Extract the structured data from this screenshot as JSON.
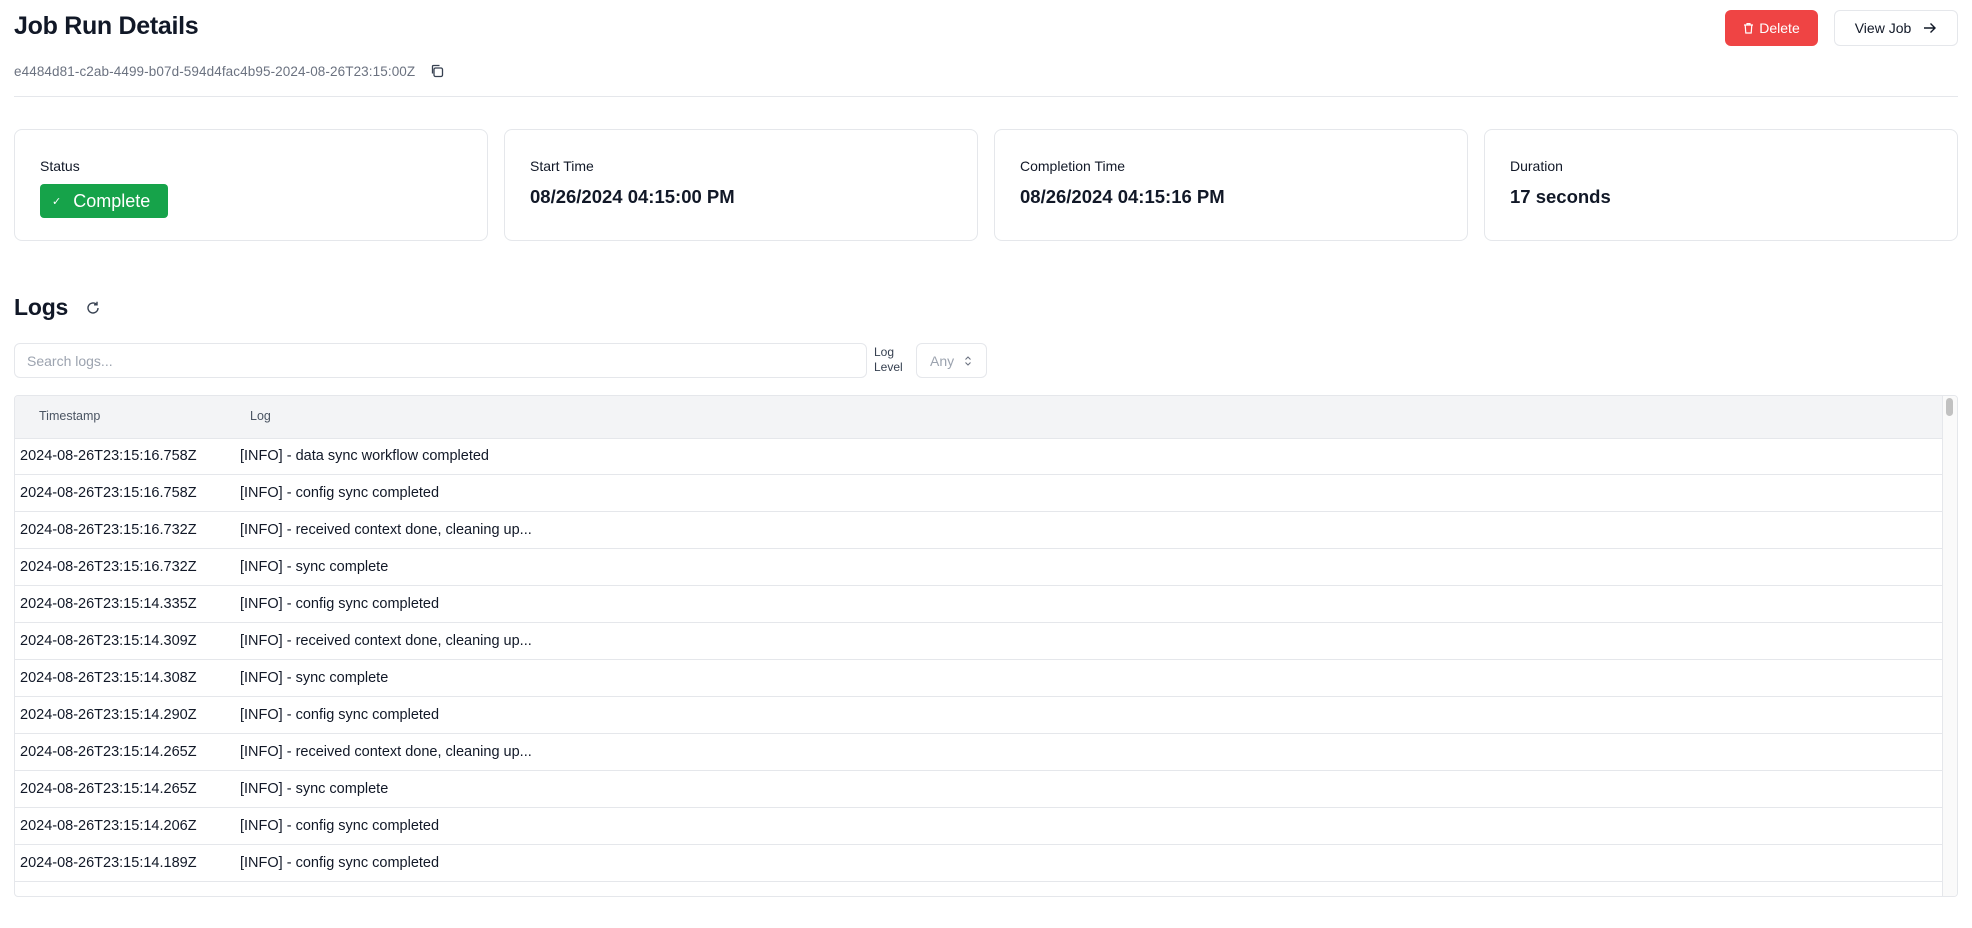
{
  "header": {
    "title": "Job Run Details",
    "delete_label": "Delete",
    "view_job_label": "View Job",
    "run_id": "e4484d81-c2ab-4499-b07d-594d4fac4b95-2024-08-26T23:15:00Z"
  },
  "cards": {
    "status": {
      "label": "Status",
      "value": "Complete",
      "color": "#16a34a"
    },
    "start_time": {
      "label": "Start Time",
      "value": "08/26/2024 04:15:00 PM"
    },
    "completion_time": {
      "label": "Completion Time",
      "value": "08/26/2024 04:15:16 PM"
    },
    "duration": {
      "label": "Duration",
      "value": "17 seconds"
    }
  },
  "logs": {
    "title": "Logs",
    "search_placeholder": "Search logs...",
    "level_label": "Log Level",
    "level_value": "Any",
    "columns": {
      "timestamp": "Timestamp",
      "log": "Log"
    },
    "rows": [
      {
        "timestamp": "2024-08-26T23:15:16.758Z",
        "log": "[INFO] - data sync workflow completed"
      },
      {
        "timestamp": "2024-08-26T23:15:16.758Z",
        "log": "[INFO] - config sync completed"
      },
      {
        "timestamp": "2024-08-26T23:15:16.732Z",
        "log": "[INFO] - received context done, cleaning up..."
      },
      {
        "timestamp": "2024-08-26T23:15:16.732Z",
        "log": "[INFO] - sync complete"
      },
      {
        "timestamp": "2024-08-26T23:15:14.335Z",
        "log": "[INFO] - config sync completed"
      },
      {
        "timestamp": "2024-08-26T23:15:14.309Z",
        "log": "[INFO] - received context done, cleaning up..."
      },
      {
        "timestamp": "2024-08-26T23:15:14.308Z",
        "log": "[INFO] - sync complete"
      },
      {
        "timestamp": "2024-08-26T23:15:14.290Z",
        "log": "[INFO] - config sync completed"
      },
      {
        "timestamp": "2024-08-26T23:15:14.265Z",
        "log": "[INFO] - received context done, cleaning up..."
      },
      {
        "timestamp": "2024-08-26T23:15:14.265Z",
        "log": "[INFO] - sync complete"
      },
      {
        "timestamp": "2024-08-26T23:15:14.206Z",
        "log": "[INFO] - config sync completed"
      },
      {
        "timestamp": "2024-08-26T23:15:14.189Z",
        "log": "[INFO] - config sync completed"
      }
    ]
  },
  "colors": {
    "danger": "#ef4444",
    "success": "#16a34a"
  },
  "icons": {
    "delete": "trash-icon",
    "view_job": "arrow-right-icon",
    "copy": "copy-icon",
    "refresh": "refresh-icon",
    "select": "chevron-updown-icon"
  }
}
